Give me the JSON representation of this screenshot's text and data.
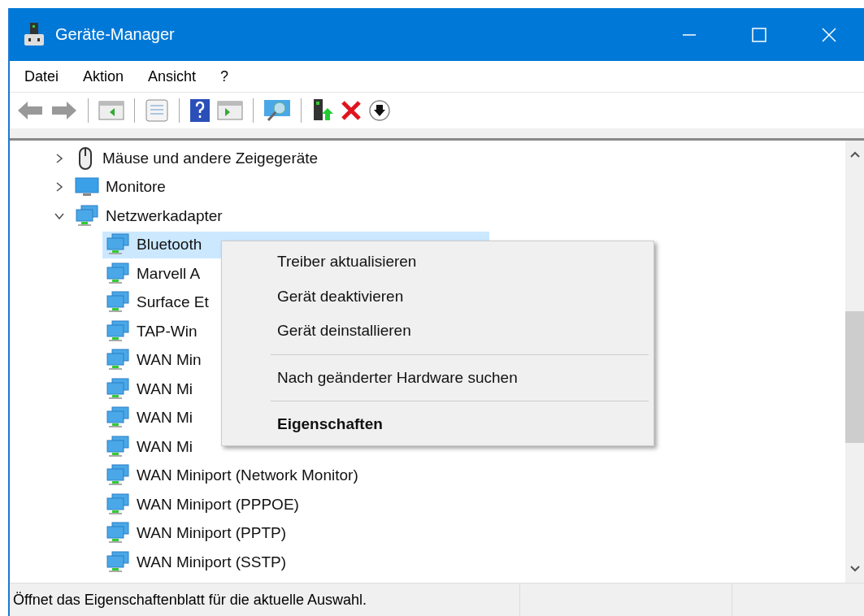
{
  "window": {
    "title": "Geräte-Manager"
  },
  "menu": [
    {
      "label": "Datei"
    },
    {
      "label": "Aktion"
    },
    {
      "label": "Ansicht"
    },
    {
      "label": "?"
    }
  ],
  "tree": [
    {
      "label": "Mäuse und andere Zeigegeräte",
      "kind": "mouse",
      "expanded": false
    },
    {
      "label": "Monitore",
      "kind": "monitor",
      "expanded": false
    },
    {
      "label": "Netzwerkadapter",
      "kind": "network",
      "expanded": true,
      "children": [
        {
          "label": "Bluetooth",
          "selected": true
        },
        {
          "label": "Marvell A",
          "selected": false
        },
        {
          "label": "Surface Et",
          "selected": false
        },
        {
          "label": "TAP-Win",
          "selected": false
        },
        {
          "label": "WAN Min",
          "selected": false
        },
        {
          "label": "WAN Mi",
          "selected": false
        },
        {
          "label": "WAN Mi",
          "selected": false
        },
        {
          "label": "WAN Mi",
          "selected": false
        },
        {
          "label": "WAN Miniport (Network Monitor)",
          "selected": false
        },
        {
          "label": "WAN Miniport (PPPOE)",
          "selected": false
        },
        {
          "label": "WAN Miniport (PPTP)",
          "selected": false
        },
        {
          "label": "WAN Miniport (SSTP)",
          "selected": false
        }
      ]
    }
  ],
  "context_menu": [
    {
      "kind": "item",
      "label": "Treiber aktualisieren",
      "bold": false
    },
    {
      "kind": "item",
      "label": "Gerät deaktivieren",
      "bold": false
    },
    {
      "kind": "item",
      "label": "Gerät deinstallieren",
      "bold": false
    },
    {
      "kind": "separator"
    },
    {
      "kind": "item",
      "label": "Nach geänderter Hardware suchen",
      "bold": false
    },
    {
      "kind": "separator"
    },
    {
      "kind": "item",
      "label": "Eigenschaften",
      "bold": true
    }
  ],
  "status_bar": {
    "text": "Öffnet das Eigenschaftenblatt für die aktuelle Auswahl."
  }
}
